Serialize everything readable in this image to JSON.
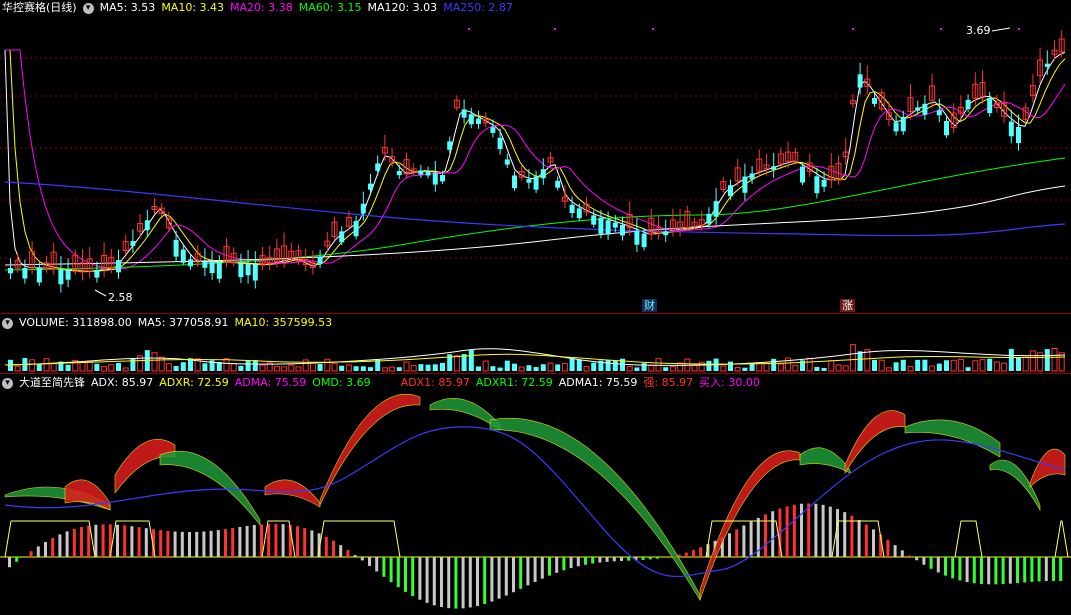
{
  "main": {
    "title": "华控赛格(日线)",
    "ma": [
      {
        "label": "MA5: 3.53",
        "color": "#ffffff"
      },
      {
        "label": "MA10: 3.43",
        "color": "#ffff00"
      },
      {
        "label": "MA20: 3.38",
        "color": "#ff00ff"
      },
      {
        "label": "MA60: 3.15",
        "color": "#00ff00"
      },
      {
        "label": "MA120: 3.03",
        "color": "#ffffff"
      },
      {
        "label": "MA250: 2.87",
        "color": "#3a3aff"
      }
    ],
    "high_label": "3.69",
    "low_label": "2.58",
    "badge_cai": "财",
    "badge_zhang": "涨"
  },
  "volume": {
    "items": [
      {
        "label": "VOLUME: 311898.00",
        "color": "#ffffff"
      },
      {
        "label": "MA5: 377058.91",
        "color": "#ffffff"
      },
      {
        "label": "MA10: 357599.53",
        "color": "#ffff00"
      }
    ]
  },
  "indicator": {
    "name": "大道至简先锋",
    "items": [
      {
        "label": "ADX: 85.97",
        "color": "#ffffff"
      },
      {
        "label": "ADXR: 72.59",
        "color": "#ffff00"
      },
      {
        "label": "ADMA: 75.59",
        "color": "#ff00ff"
      },
      {
        "label": "OMD: 3.69",
        "color": "#00ff00"
      },
      {
        "label": "ADX1: 85.97",
        "color": "#ff3030"
      },
      {
        "label": "ADXR1: 72.59",
        "color": "#00ff00"
      },
      {
        "label": "ADMA1: 75.59",
        "color": "#ffffff"
      },
      {
        "label": "强: 85.97",
        "color": "#ff3030"
      },
      {
        "label": "买入: 30.00",
        "color": "#ff00ff"
      }
    ]
  },
  "colors": {
    "up": "#ff3232",
    "down": "#54ffff",
    "grid": "#8b0000",
    "bg": "#000000"
  }
}
